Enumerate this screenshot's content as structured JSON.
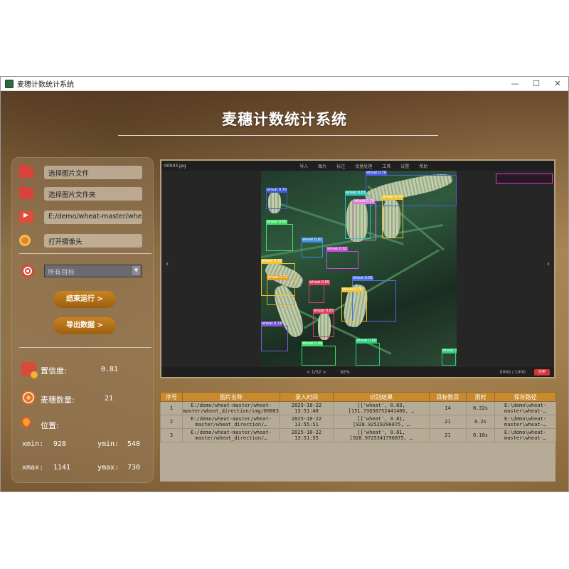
{
  "window": {
    "title": "麦穗计数统计系统",
    "controls": [
      "—",
      "☐",
      "✕"
    ]
  },
  "header": {
    "title": "麦穗计数统计系统"
  },
  "sidebar": {
    "select_image": "选择图片文件",
    "select_folder": "选择图片文件夹",
    "video_path": "E:/demo/wheat-master/wheat-",
    "open_camera": "打开摄像头",
    "target_combo": "所有目标",
    "stop_button": "结束运行 >",
    "export_button": "导出数据 >",
    "confidence_label": "置信度:",
    "confidence_value": "0.81",
    "count_label": "麦穗数量:",
    "count_value": "21",
    "position_label": "位置:",
    "xmin_label": "xmin:",
    "xmin_value": "928",
    "ymin_label": "ymin:",
    "ymin_value": "540",
    "xmax_label": "xmax:",
    "xmax_value": "1141",
    "ymax_label": "ymax:",
    "ymax_value": "730"
  },
  "viewer": {
    "filename": "00003.jpg",
    "menu": [
      "导入",
      "图片",
      "标注",
      "批量处理",
      "工具",
      "设置",
      "帮助"
    ],
    "page": "< 1/32 >",
    "zoom": "92%",
    "right_info": "0000 / 1000",
    "red_button": "应用"
  },
  "detections": [
    {
      "label": "wheat 0.76",
      "color": "#3f5bd6"
    },
    {
      "label": "wheat 0.81",
      "color": "#6f5ee3"
    },
    {
      "label": "wheat 0.83",
      "color": "#2ec4b6"
    },
    {
      "label": "wheat 0.79",
      "color": "#e27adf"
    },
    {
      "label": "wheat 0.82",
      "color": "#c94cd6"
    },
    {
      "label": "wheat 0.76",
      "color": "#f0c332"
    },
    {
      "label": "wheat 0.80",
      "color": "#3ee06a"
    },
    {
      "label": "wheat 0.73",
      "color": "#e8a12a"
    },
    {
      "label": "wheat 0.85",
      "color": "#e23e6a"
    },
    {
      "label": "wheat 0.74",
      "color": "#7c5ad6"
    },
    {
      "label": "wheat 0.81",
      "color": "#4a6fe0"
    },
    {
      "label": "wheat 0.86",
      "color": "#2bd17a"
    }
  ],
  "table": {
    "headers": [
      "序号",
      "图片名称",
      "录入时间",
      "识别结果",
      "目标数目",
      "用时",
      "保存路径"
    ],
    "rows": [
      [
        "1",
        "E:/demo/wheat-master/wheat-master/wheat_direction/img/00003.jpg",
        "2025-10-22 13:51:48",
        "[['wheat', 0.83, [151.73658752441406, …",
        "14",
        "0.32s",
        "E:\\demo\\wheat-master\\wheat-…"
      ],
      [
        "2",
        "E:/demo/wheat-master/wheat-master/wheat_direction/…",
        "2025-10-22 13:55:51",
        "[['wheat', 0.81, [928.92529296875, …",
        "21",
        "0.2s",
        "E:\\demo\\wheat-master\\wheat-…"
      ],
      [
        "3",
        "E:/demo/wheat-master/wheat-master/wheat_direction/…",
        "2025-10-22 13:51:55",
        "[['wheat', 0.81, [928.9725341796875, …",
        "21",
        "0.18s",
        "E:\\demo\\wheat-master\\wheat-…"
      ]
    ]
  },
  "colors": {
    "accent": "#c88a2c",
    "panel": "#967855"
  }
}
